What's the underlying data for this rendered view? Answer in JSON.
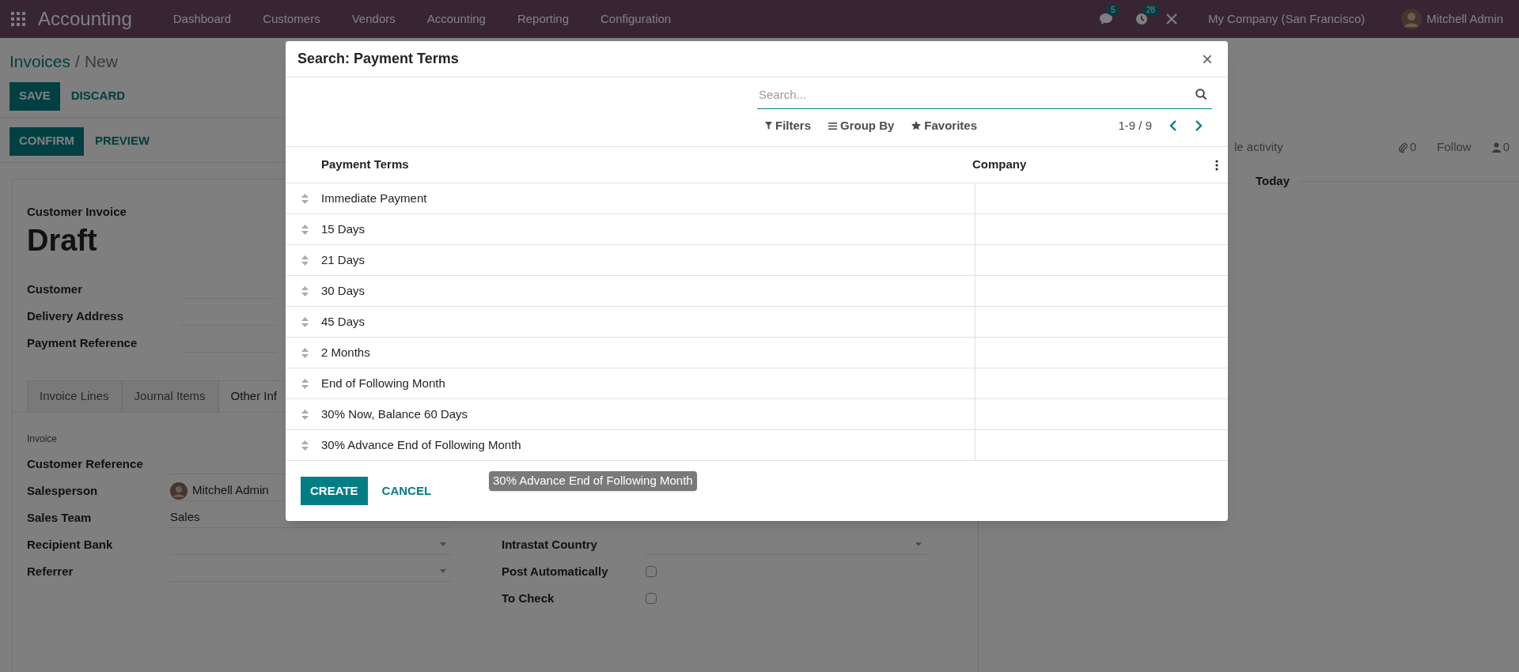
{
  "navbar": {
    "app_name": "Accounting",
    "menu": [
      "Dashboard",
      "Customers",
      "Vendors",
      "Accounting",
      "Reporting",
      "Configuration"
    ],
    "chat_badge": "5",
    "activity_badge": "28",
    "company": "My Company (San Francisco)",
    "user": "Mitchell Admin"
  },
  "breadcrumb": {
    "parent": "Invoices",
    "separator": "/",
    "current": "New"
  },
  "primary_buttons": [
    "SAVE",
    "DISCARD"
  ],
  "status_buttons": [
    "CONFIRM",
    "PREVIEW"
  ],
  "chatter": {
    "schedule": "le activity",
    "attachments": "0",
    "follow": "Follow",
    "followers": "0",
    "date_separator": "Today"
  },
  "form": {
    "type_label": "Customer Invoice",
    "status": "Draft",
    "fields": [
      "Customer",
      "Delivery Address",
      "Payment Reference"
    ],
    "tabs": [
      {
        "label": "Invoice Lines",
        "selected": false
      },
      {
        "label": "Journal Items",
        "selected": false
      },
      {
        "label": "Other Inf",
        "selected": true
      }
    ],
    "section": "Invoice",
    "left_fields": [
      {
        "label": "Customer Reference",
        "kind": "text"
      },
      {
        "label": "Salesperson",
        "kind": "user",
        "value": "Mitchell Admin"
      },
      {
        "label": "Sales Team",
        "kind": "text",
        "value": "Sales"
      },
      {
        "label": "Recipient Bank",
        "kind": "select"
      },
      {
        "label": "Referrer",
        "kind": "select"
      }
    ],
    "right_fields": [
      {
        "label": "Intrastat Country",
        "kind": "select"
      },
      {
        "label": "Post Automatically",
        "kind": "checkbox",
        "checked": false
      },
      {
        "label": "To Check",
        "kind": "checkbox",
        "checked": false
      }
    ]
  },
  "modal": {
    "title": "Search: Payment Terms",
    "close": "×",
    "search_placeholder": "Search...",
    "filters": "Filters",
    "group_by": "Group By",
    "favorites": "Favorites",
    "pager": "1-9 / 9",
    "columns": [
      "Payment Terms",
      "Company"
    ],
    "rows": [
      "Immediate Payment",
      "15 Days",
      "21 Days",
      "30 Days",
      "45 Days",
      "2 Months",
      "End of Following Month",
      "30% Now, Balance 60 Days",
      "30% Advance End of Following Month"
    ],
    "buttons": [
      "CREATE",
      "CANCEL"
    ],
    "tooltip": "30% Advance End of Following Month"
  }
}
